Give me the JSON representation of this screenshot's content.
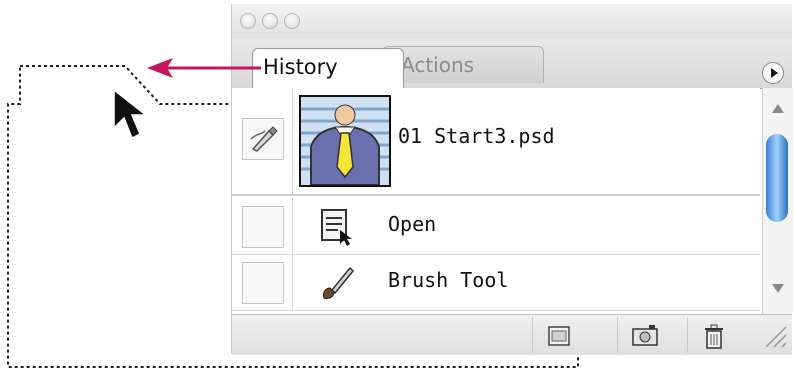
{
  "tabs": {
    "history_label": "History",
    "actions_label": "Actions"
  },
  "snapshot": {
    "name": "01 Start3.psd"
  },
  "steps": [
    {
      "label": "Open",
      "icon": "open-document-icon"
    },
    {
      "label": "Brush Tool",
      "icon": "brush-icon"
    }
  ],
  "toolbar": {
    "buttons": [
      "new-document-from-state-icon",
      "create-snapshot-icon",
      "trash-icon"
    ]
  },
  "colors": {
    "annotation_arrow": "#c2185b",
    "scroll_thumb": "#3d7fcf"
  }
}
